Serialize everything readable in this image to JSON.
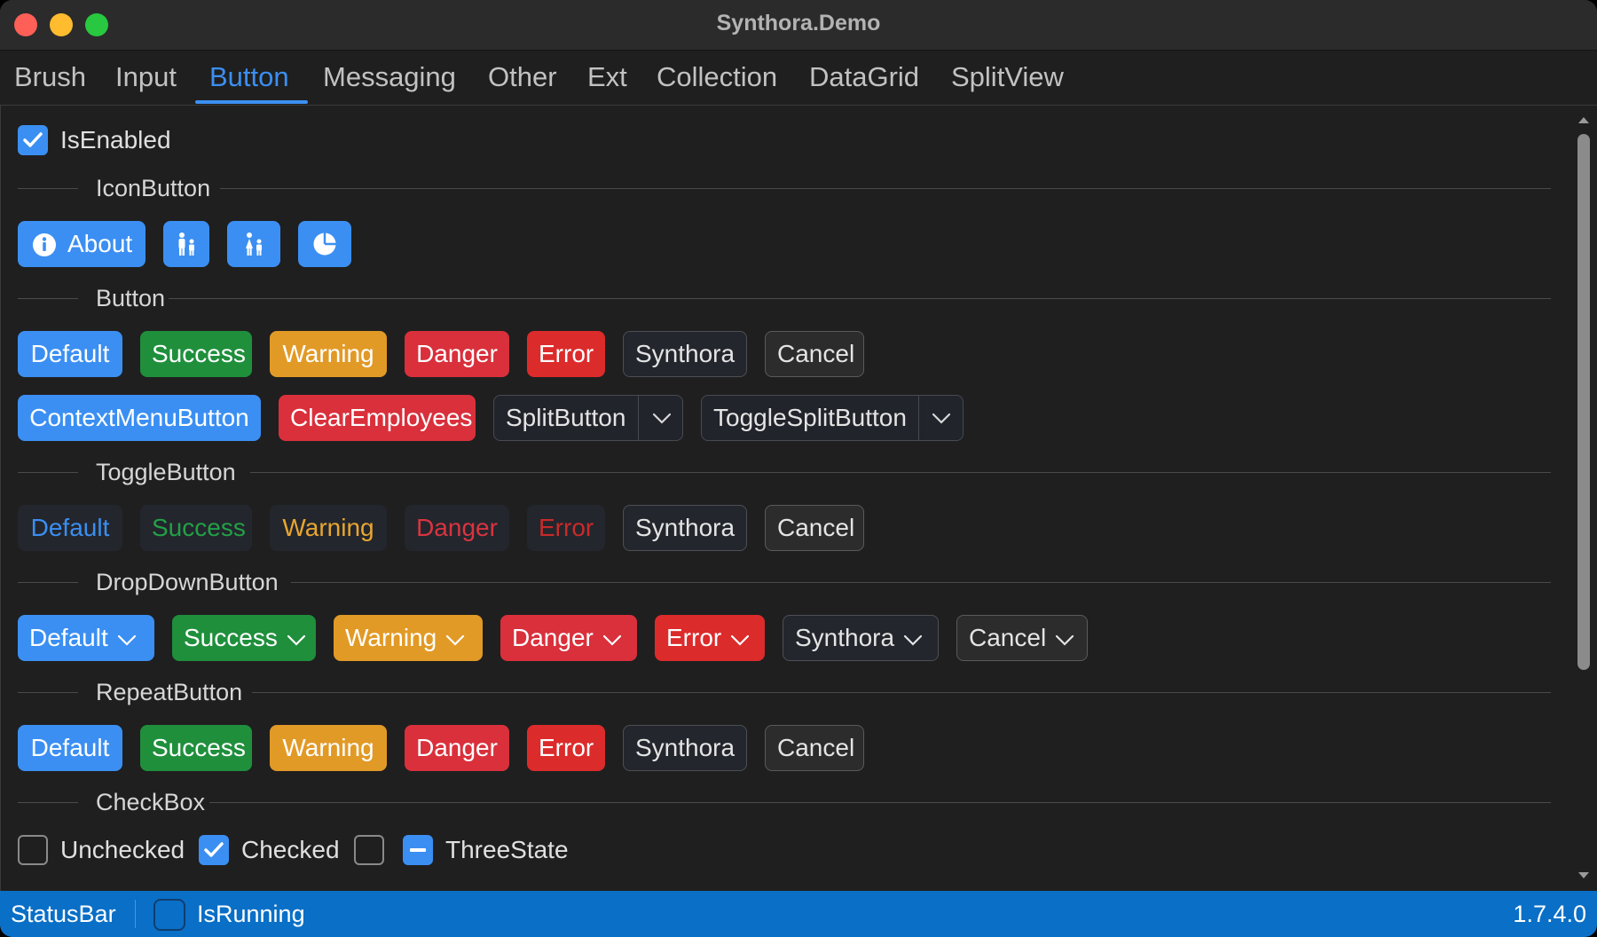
{
  "window": {
    "title": "Synthora.Demo"
  },
  "tabs": [
    "Brush",
    "Input",
    "Button",
    "Messaging",
    "Other",
    "Ext",
    "Collection",
    "DataGrid",
    "SplitView"
  ],
  "active_tab": "Button",
  "is_enabled": {
    "label": "IsEnabled",
    "checked": true
  },
  "sections": {
    "icon_button": "IconButton",
    "button": "Button",
    "toggle_button": "ToggleButton",
    "dropdown_button": "DropDownButton",
    "repeat_button": "RepeatButton",
    "checkbox": "CheckBox"
  },
  "icon_buttons": {
    "about_label": "About",
    "icons": [
      "info-icon",
      "family-icon",
      "family-alt-icon",
      "pie-chart-icon"
    ]
  },
  "buttons": [
    "Default",
    "Success",
    "Warning",
    "Danger",
    "Error",
    "Synthora",
    "Cancel"
  ],
  "button_row2": {
    "context_menu": "ContextMenuButton",
    "clear_employees": "ClearEmployees",
    "split": "SplitButton",
    "toggle_split": "ToggleSplitButton"
  },
  "toggle_buttons": [
    "Default",
    "Success",
    "Warning",
    "Danger",
    "Error",
    "Synthora",
    "Cancel"
  ],
  "dropdown_buttons": [
    "Default",
    "Success",
    "Warning",
    "Danger",
    "Error",
    "Synthora",
    "Cancel"
  ],
  "repeat_buttons": [
    "Default",
    "Success",
    "Warning",
    "Danger",
    "Error",
    "Synthora",
    "Cancel"
  ],
  "checkboxes": [
    {
      "label": "Unchecked",
      "state": "unchecked"
    },
    {
      "label": "Checked",
      "state": "checked"
    },
    {
      "label": "",
      "state": "unchecked"
    },
    {
      "label": "ThreeState",
      "state": "indeterminate"
    }
  ],
  "status_bar": {
    "label": "StatusBar",
    "is_running_label": "IsRunning",
    "is_running": false,
    "version": "1.7.4.0"
  },
  "colors": {
    "accent": "#3b8ff2",
    "success": "#1f8f3c",
    "warning": "#e29a26",
    "danger": "#d9303c",
    "error": "#dc2b2b",
    "status_bar": "#0a6fc6"
  }
}
